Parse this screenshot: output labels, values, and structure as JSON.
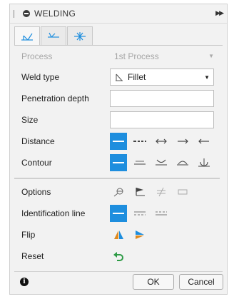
{
  "panel": {
    "title": "WELDING"
  },
  "tabs": [
    {
      "name": "fillet-weld-tab",
      "active": true
    },
    {
      "name": "groove-weld-tab",
      "active": false
    },
    {
      "name": "both-sides-weld-tab",
      "active": false
    }
  ],
  "form": {
    "process": {
      "label": "Process",
      "value": "1st Process"
    },
    "weld_type": {
      "label": "Weld type",
      "value": "Fillet"
    },
    "penetration_depth": {
      "label": "Penetration depth",
      "value": ""
    },
    "size": {
      "label": "Size",
      "value": ""
    },
    "distance": {
      "label": "Distance",
      "options": [
        "solid-line-icon",
        "dashed-line-icon",
        "double-arrow-icon",
        "arrow-right-icon",
        "arrow-left-icon"
      ],
      "selected": 0
    },
    "contour": {
      "label": "Contour",
      "options": [
        "none-icon",
        "flat-icon",
        "concave-icon",
        "convex-icon",
        "grind-icon"
      ],
      "selected": 0
    },
    "options": {
      "label": "Options"
    },
    "identification_line": {
      "label": "Identification line",
      "selected": 0
    },
    "flip": {
      "label": "Flip"
    },
    "reset": {
      "label": "Reset"
    }
  },
  "footer": {
    "ok_label": "OK",
    "cancel_label": "Cancel"
  },
  "colors": {
    "accent": "#1e8ede",
    "reset_green": "#2e9b46"
  }
}
